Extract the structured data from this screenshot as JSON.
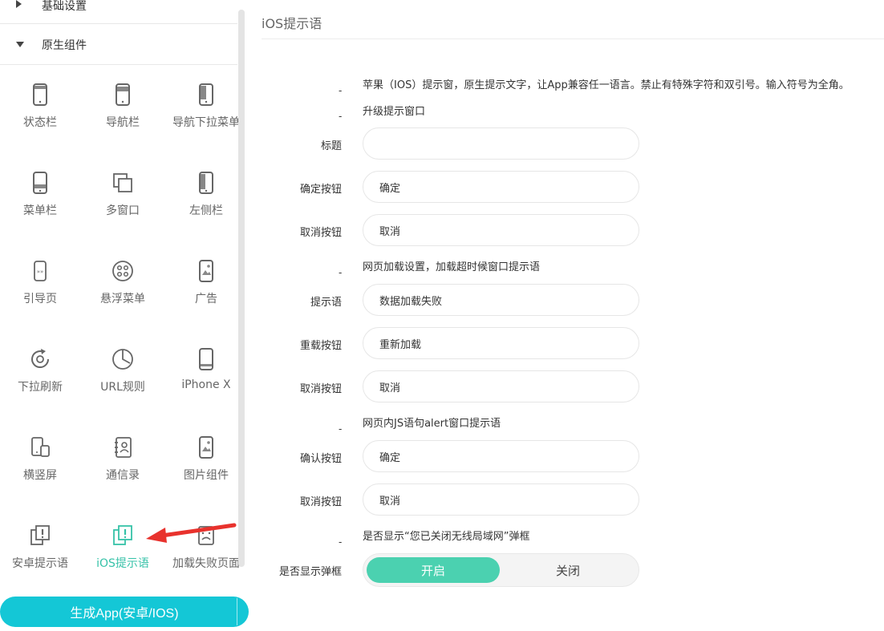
{
  "sidebar": {
    "sections": [
      {
        "label": "基础设置",
        "expanded": false
      },
      {
        "label": "原生组件",
        "expanded": true
      }
    ],
    "items": [
      {
        "label": "状态栏",
        "icon": "phone-status-bar-icon"
      },
      {
        "label": "导航栏",
        "icon": "phone-navbar-icon"
      },
      {
        "label": "导航下拉菜单",
        "icon": "phone-dropdown-menu-icon"
      },
      {
        "label": "菜单栏",
        "icon": "phone-menu-bar-icon"
      },
      {
        "label": "多窗口",
        "icon": "multi-window-icon"
      },
      {
        "label": "左侧栏",
        "icon": "phone-left-sidebar-icon"
      },
      {
        "label": "引导页",
        "icon": "guide-page-icon"
      },
      {
        "label": "悬浮菜单",
        "icon": "floating-menu-icon"
      },
      {
        "label": "广告",
        "icon": "ad-icon"
      },
      {
        "label": "下拉刷新",
        "icon": "pull-refresh-icon"
      },
      {
        "label": "URL规则",
        "icon": "url-rule-icon"
      },
      {
        "label": "iPhone X",
        "icon": "iphone-x-icon"
      },
      {
        "label": "横竖屏",
        "icon": "screen-rotate-icon"
      },
      {
        "label": "通信录",
        "icon": "contacts-icon"
      },
      {
        "label": "图片组件",
        "icon": "image-component-icon"
      },
      {
        "label": "安卓提示语",
        "icon": "android-alert-icon"
      },
      {
        "label": "iOS提示语",
        "icon": "ios-alert-icon",
        "active": true
      },
      {
        "label": "加载失败页面",
        "icon": "load-failed-icon"
      }
    ],
    "generate_button": "生成App(安卓/IOS)"
  },
  "main": {
    "title": "iOS提示语",
    "dash": "-",
    "notes": {
      "intro": "苹果（IOS）提示窗，原生提示文字，让App兼容任一语言。禁止有特殊字符和双引号。输入符号为全角。",
      "upgrade": "升级提示窗口",
      "web_loading": "网页加载设置，加载超时候窗口提示语",
      "js_alert": "网页内JS语句alert窗口提示语",
      "wifi_prompt": "是否显示“您已关闭无线局域网”弹框"
    },
    "upgrade_fields": {
      "title_label": "标题",
      "title_value": "",
      "confirm_label": "确定按钮",
      "confirm_value": "确定",
      "cancel_label": "取消按钮",
      "cancel_value": "取消"
    },
    "loading_fields": {
      "tip_label": "提示语",
      "tip_value": "数据加载失败",
      "reload_label": "重载按钮",
      "reload_value": "重新加载",
      "cancel_label": "取消按钮",
      "cancel_value": "取消"
    },
    "alert_fields": {
      "confirm_label": "确认按钮",
      "confirm_value": "确定",
      "cancel_label": "取消按钮",
      "cancel_value": "取消"
    },
    "wifi_toggle": {
      "label": "是否显示弹框",
      "on_label": "开启",
      "off_label": "关闭",
      "selected": "开启"
    }
  },
  "colors": {
    "accent": "#36c2a8",
    "toggle_on": "#4bd1b0",
    "generate_button": "#14c7d6",
    "arrow": "#e8322d"
  }
}
